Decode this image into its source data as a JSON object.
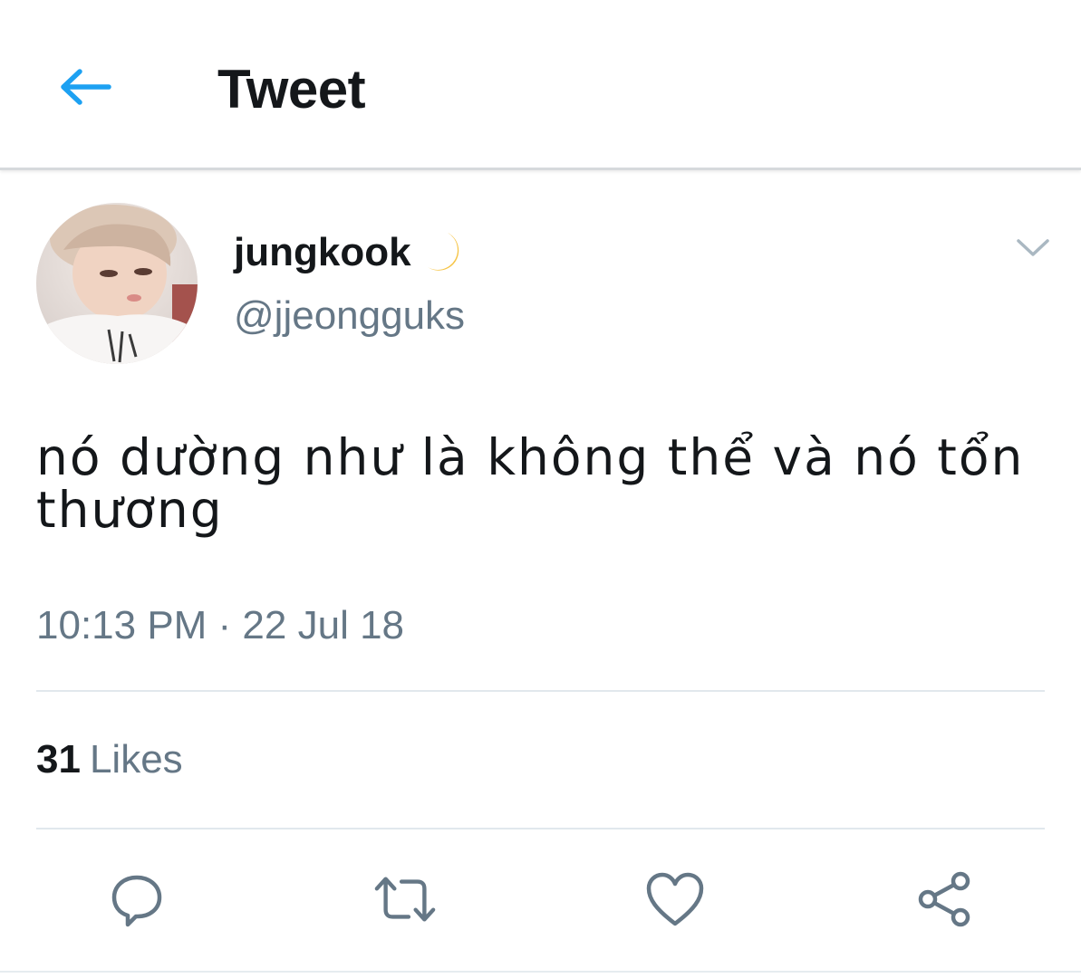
{
  "header": {
    "back_icon": "arrow-left-icon",
    "title": "Tweet",
    "accent_color": "#1da1f2"
  },
  "tweet": {
    "author": {
      "display_name": "jungkook",
      "emoji_icon": "crescent-moon-icon",
      "handle": "@jjeongguks"
    },
    "menu_icon": "chevron-down-icon",
    "text": "nó dường như là không thể và nó tổn thương",
    "timestamp": "10:13 PM · 22 Jul 18",
    "likes": {
      "count": "31",
      "label": "Likes"
    },
    "actions": [
      {
        "name": "reply",
        "icon": "reply-icon"
      },
      {
        "name": "retweet",
        "icon": "retweet-icon"
      },
      {
        "name": "like",
        "icon": "heart-icon"
      },
      {
        "name": "share",
        "icon": "share-icon"
      }
    ]
  },
  "colors": {
    "text_primary": "#14171a",
    "text_secondary": "#657786",
    "divider": "#e1e8ed",
    "icon_gray": "#657786"
  }
}
